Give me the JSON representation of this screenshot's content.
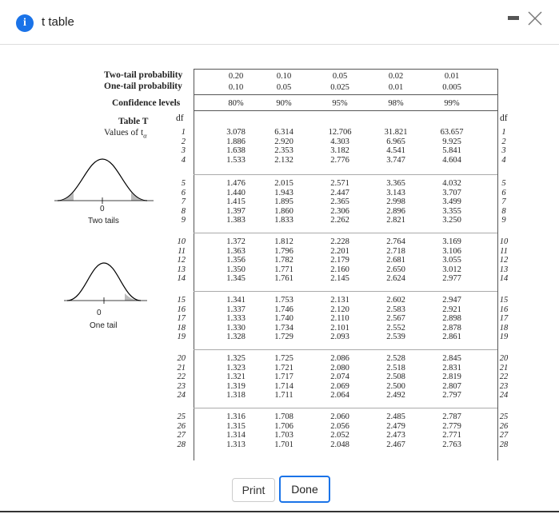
{
  "window": {
    "title": "t table"
  },
  "table": {
    "title": "Table T",
    "subtitle": "Values of t",
    "rows_header": {
      "two_tail": "Two-tail probability",
      "one_tail": "One-tail probability",
      "confidence": "Confidence levels"
    },
    "df_label": "df",
    "two_tail_values": [
      "0.20",
      "0.10",
      "0.05",
      "0.02",
      "0.01"
    ],
    "one_tail_values": [
      "0.10",
      "0.05",
      "0.025",
      "0.01",
      "0.005"
    ],
    "confidence_values": [
      "80%",
      "90%",
      "95%",
      "98%",
      "99%"
    ],
    "blocks": [
      {
        "df": [
          "1",
          "2",
          "3",
          "4"
        ],
        "cols": [
          [
            "3.078",
            "1.886",
            "1.638",
            "1.533"
          ],
          [
            "6.314",
            "2.920",
            "2.353",
            "2.132"
          ],
          [
            "12.706",
            "4.303",
            "3.182",
            "2.776"
          ],
          [
            "31.821",
            "6.965",
            "4.541",
            "3.747"
          ],
          [
            "63.657",
            "9.925",
            "5.841",
            "4.604"
          ]
        ]
      },
      {
        "df": [
          "5",
          "6",
          "7",
          "8",
          "9"
        ],
        "cols": [
          [
            "1.476",
            "1.440",
            "1.415",
            "1.397",
            "1.383"
          ],
          [
            "2.015",
            "1.943",
            "1.895",
            "1.860",
            "1.833"
          ],
          [
            "2.571",
            "2.447",
            "2.365",
            "2.306",
            "2.262"
          ],
          [
            "3.365",
            "3.143",
            "2.998",
            "2.896",
            "2.821"
          ],
          [
            "4.032",
            "3.707",
            "3.499",
            "3.355",
            "3.250"
          ]
        ]
      },
      {
        "df": [
          "10",
          "11",
          "12",
          "13",
          "14"
        ],
        "cols": [
          [
            "1.372",
            "1.363",
            "1.356",
            "1.350",
            "1.345"
          ],
          [
            "1.812",
            "1.796",
            "1.782",
            "1.771",
            "1.761"
          ],
          [
            "2.228",
            "2.201",
            "2.179",
            "2.160",
            "2.145"
          ],
          [
            "2.764",
            "2.718",
            "2.681",
            "2.650",
            "2.624"
          ],
          [
            "3.169",
            "3.106",
            "3.055",
            "3.012",
            "2.977"
          ]
        ]
      },
      {
        "df": [
          "15",
          "16",
          "17",
          "18",
          "19"
        ],
        "cols": [
          [
            "1.341",
            "1.337",
            "1.333",
            "1.330",
            "1.328"
          ],
          [
            "1.753",
            "1.746",
            "1.740",
            "1.734",
            "1.729"
          ],
          [
            "2.131",
            "2.120",
            "2.110",
            "2.101",
            "2.093"
          ],
          [
            "2.602",
            "2.583",
            "2.567",
            "2.552",
            "2.539"
          ],
          [
            "2.947",
            "2.921",
            "2.898",
            "2.878",
            "2.861"
          ]
        ]
      },
      {
        "df": [
          "20",
          "21",
          "22",
          "23",
          "24"
        ],
        "cols": [
          [
            "1.325",
            "1.323",
            "1.321",
            "1.319",
            "1.318"
          ],
          [
            "1.725",
            "1.721",
            "1.717",
            "1.714",
            "1.711"
          ],
          [
            "2.086",
            "2.080",
            "2.074",
            "2.069",
            "2.064"
          ],
          [
            "2.528",
            "2.518",
            "2.508",
            "2.500",
            "2.492"
          ],
          [
            "2.845",
            "2.831",
            "2.819",
            "2.807",
            "2.797"
          ]
        ]
      },
      {
        "df": [
          "25",
          "26",
          "27",
          "28"
        ],
        "cols": [
          [
            "1.316",
            "1.315",
            "1.314",
            "1.313"
          ],
          [
            "1.708",
            "1.706",
            "1.703",
            "1.701"
          ],
          [
            "2.060",
            "2.056",
            "2.052",
            "2.048"
          ],
          [
            "2.485",
            "2.479",
            "2.473",
            "2.467"
          ],
          [
            "2.787",
            "2.779",
            "2.771",
            "2.763"
          ]
        ]
      }
    ],
    "two_tails_label": "Two tails",
    "one_tail_label": "One tail",
    "zero_label": "0"
  },
  "buttons": {
    "print": "Print",
    "done": "Done"
  },
  "colors": {
    "accent": "#1a73e8"
  }
}
